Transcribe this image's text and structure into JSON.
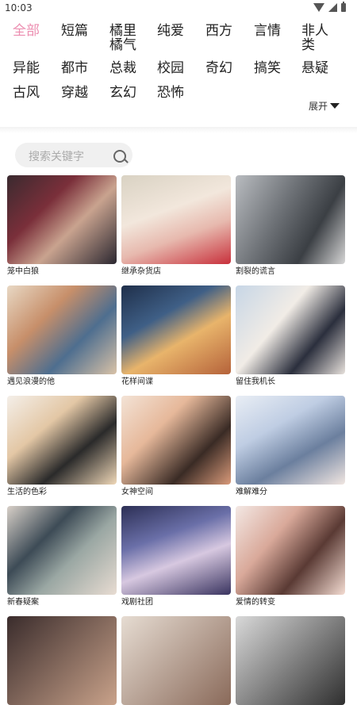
{
  "status": {
    "time": "10:03"
  },
  "categories": [
    "全部",
    "短篇",
    "橘里\n橘气",
    "纯爱",
    "西方",
    "言情",
    "非人\n类",
    "异能",
    "都市",
    "总裁",
    "校园",
    "奇幻",
    "搞笑",
    "悬疑",
    "古风",
    "穿越",
    "玄幻",
    "恐怖"
  ],
  "expand_label": "展开",
  "search": {
    "placeholder": "搜索关键字"
  },
  "comics": [
    {
      "title": "笼中白狼"
    },
    {
      "title": "继承杂货店"
    },
    {
      "title": "割裂的谎言"
    },
    {
      "title": "遇见浪漫的他"
    },
    {
      "title": "花样间谍"
    },
    {
      "title": "留住我机长"
    },
    {
      "title": "生活的色彩"
    },
    {
      "title": "女神空间"
    },
    {
      "title": "难解难分"
    },
    {
      "title": "新春疑案"
    },
    {
      "title": "戏剧社团"
    },
    {
      "title": "爱情的转变"
    }
  ],
  "colors": {
    "accent": "#ec8db0"
  }
}
